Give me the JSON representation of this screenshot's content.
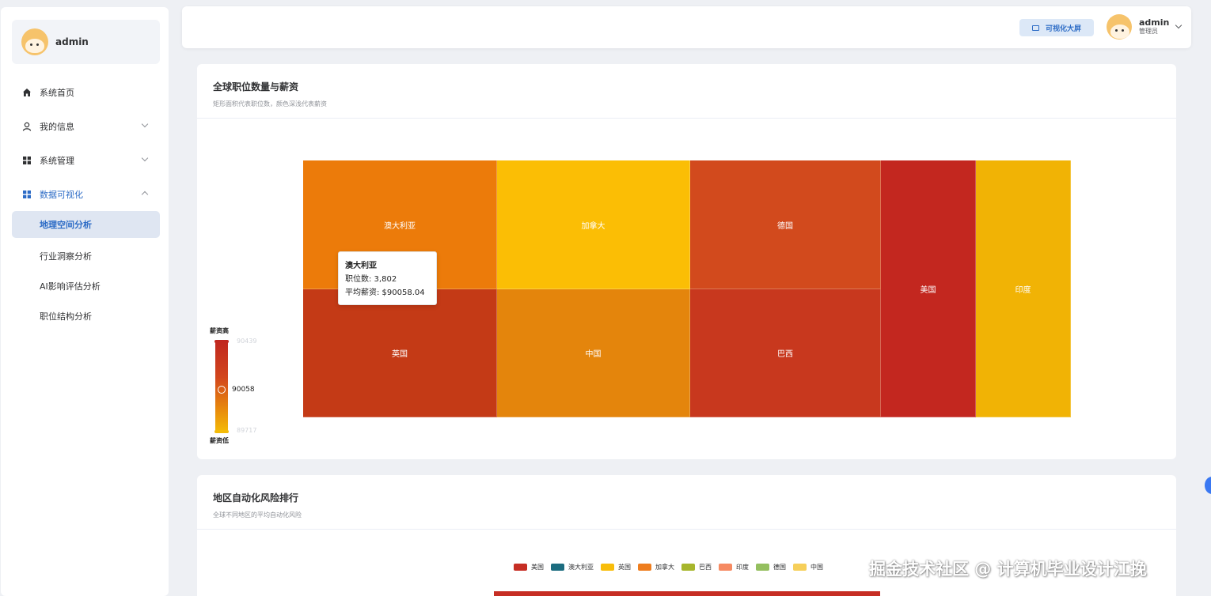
{
  "sidebar": {
    "username": "admin",
    "menu": [
      {
        "label": "系统首页",
        "icon": "home-icon"
      },
      {
        "label": "我的信息",
        "icon": "user-icon"
      },
      {
        "label": "系统管理",
        "icon": "grid-icon"
      },
      {
        "label": "数据可视化",
        "icon": "grid-icon"
      }
    ],
    "submenu": [
      "地理空间分析",
      "行业洞察分析",
      "AI影响评估分析",
      "职位结构分析"
    ]
  },
  "header": {
    "bigscreen_label": "可视化大屏",
    "username": "admin",
    "role": "管理员"
  },
  "card1": {
    "title": "全球职位数量与薪资",
    "subtitle": "矩形面积代表职位数，颜色深浅代表薪资"
  },
  "card2": {
    "title": "地区自动化风险排行",
    "subtitle": "全球不同地区的平均自动化风险"
  },
  "chart_data": [
    {
      "type": "treemap",
      "cells": [
        {
          "name": "澳大利亚",
          "jobs": 3802,
          "salary": 90058.04,
          "color": "#ec7b0a"
        },
        {
          "name": "英国",
          "color": "#c43a16"
        },
        {
          "name": "加拿大",
          "color": "#fbbe05"
        },
        {
          "name": "中国",
          "color": "#e4850c"
        },
        {
          "name": "德国",
          "color": "#d24a1d"
        },
        {
          "name": "巴西",
          "color": "#c8381e"
        },
        {
          "name": "美国",
          "color": "#c3271f"
        },
        {
          "name": "印度",
          "color": "#f1b305"
        }
      ],
      "tooltip": {
        "name": "澳大利亚",
        "jobs_label": "职位数: 3,802",
        "salary_label": "平均薪资: $90058.04"
      },
      "visual_map": {
        "high_label": "薪资高",
        "low_label": "薪资低",
        "max": "90439",
        "min": "89717",
        "current": "90058"
      }
    },
    {
      "type": "bar",
      "legend": [
        {
          "name": "美国",
          "color": "#c62e24"
        },
        {
          "name": "澳大利亚",
          "color": "#1b6c7f"
        },
        {
          "name": "英国",
          "color": "#f8bd0a"
        },
        {
          "name": "加拿大",
          "color": "#ee7d1e"
        },
        {
          "name": "巴西",
          "color": "#a7b62c"
        },
        {
          "name": "印度",
          "color": "#f68a62"
        },
        {
          "name": "德国",
          "color": "#94bf5f"
        },
        {
          "name": "中国",
          "color": "#f6cf5a"
        }
      ]
    }
  ],
  "watermark": "掘金技术社区 @ 计算机毕业设计江挽"
}
